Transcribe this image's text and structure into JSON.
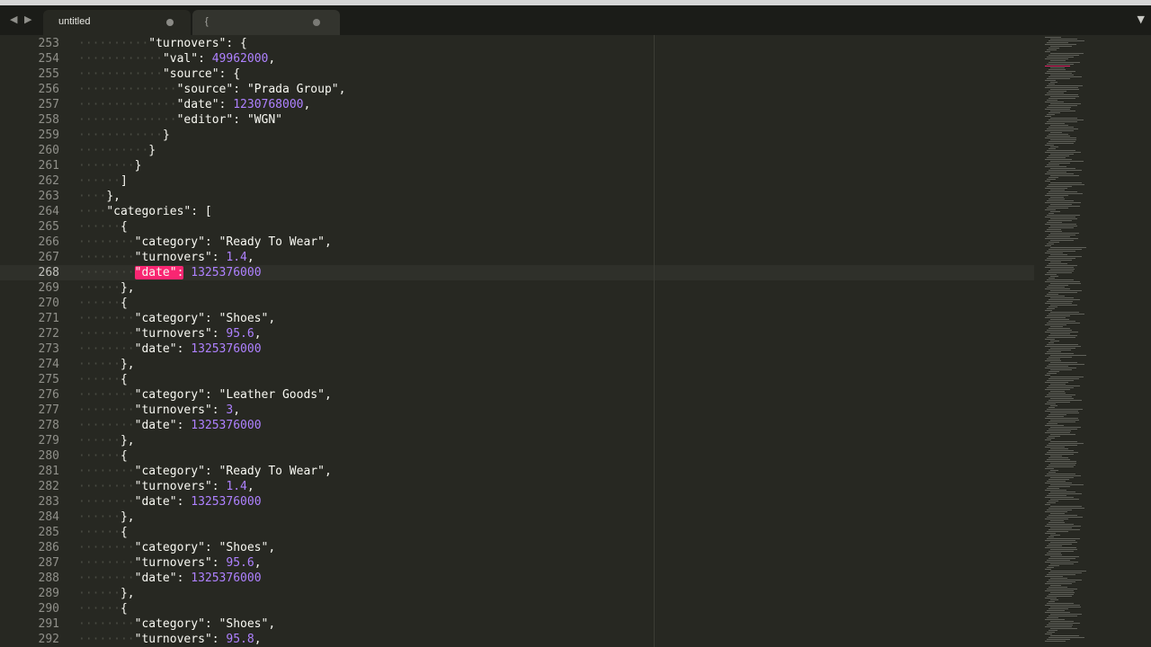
{
  "tabs": [
    {
      "label": "untitled",
      "active": true
    },
    {
      "label": "{",
      "active": false
    }
  ],
  "icons": {
    "nav_back": "◀",
    "nav_forward": "▶",
    "tab_menu": "▼"
  },
  "colors": {
    "background": "#272822",
    "number": "#ae81ff",
    "highlight": "#f92672",
    "text": "#f8f8f2"
  },
  "editor": {
    "current_line": 268,
    "lines": [
      {
        "n": "253",
        "indent": 5,
        "parts": [
          {
            "t": "\"turnovers\": {",
            "c": "s"
          }
        ]
      },
      {
        "n": "254",
        "indent": 6,
        "parts": [
          {
            "t": "\"val\": ",
            "c": "s"
          },
          {
            "t": "49962000",
            "c": "num"
          },
          {
            "t": ",",
            "c": "s"
          }
        ]
      },
      {
        "n": "255",
        "indent": 6,
        "parts": [
          {
            "t": "\"source\": {",
            "c": "s"
          }
        ]
      },
      {
        "n": "256",
        "indent": 7,
        "parts": [
          {
            "t": "\"source\": \"Prada Group\",",
            "c": "s"
          }
        ]
      },
      {
        "n": "257",
        "indent": 7,
        "parts": [
          {
            "t": "\"date\": ",
            "c": "s"
          },
          {
            "t": "1230768000",
            "c": "num"
          },
          {
            "t": ",",
            "c": "s"
          }
        ]
      },
      {
        "n": "258",
        "indent": 7,
        "parts": [
          {
            "t": "\"editor\": \"WGN\"",
            "c": "s"
          }
        ]
      },
      {
        "n": "259",
        "indent": 6,
        "parts": [
          {
            "t": "}",
            "c": "s"
          }
        ]
      },
      {
        "n": "260",
        "indent": 5,
        "parts": [
          {
            "t": "}",
            "c": "s"
          }
        ]
      },
      {
        "n": "261",
        "indent": 4,
        "parts": [
          {
            "t": "}",
            "c": "s"
          }
        ]
      },
      {
        "n": "262",
        "indent": 3,
        "parts": [
          {
            "t": "]",
            "c": "s"
          }
        ]
      },
      {
        "n": "263",
        "indent": 2,
        "parts": [
          {
            "t": "},",
            "c": "s"
          }
        ]
      },
      {
        "n": "264",
        "indent": 2,
        "parts": [
          {
            "t": "\"categories\": [",
            "c": "s"
          }
        ]
      },
      {
        "n": "265",
        "indent": 3,
        "parts": [
          {
            "t": "{",
            "c": "s"
          }
        ]
      },
      {
        "n": "266",
        "indent": 4,
        "parts": [
          {
            "t": "\"category\": \"Ready To Wear\",",
            "c": "s"
          }
        ]
      },
      {
        "n": "267",
        "indent": 4,
        "parts": [
          {
            "t": "\"turnovers\": ",
            "c": "s"
          },
          {
            "t": "1.4",
            "c": "num"
          },
          {
            "t": ",",
            "c": "s"
          }
        ]
      },
      {
        "n": "268",
        "indent": 4,
        "parts": [
          {
            "t": "\"date\":",
            "c": "hl"
          },
          {
            "t": " ",
            "c": "s"
          },
          {
            "t": "1325376000",
            "c": "num"
          }
        ]
      },
      {
        "n": "269",
        "indent": 3,
        "parts": [
          {
            "t": "},",
            "c": "s"
          }
        ]
      },
      {
        "n": "270",
        "indent": 3,
        "parts": [
          {
            "t": "{",
            "c": "s"
          }
        ]
      },
      {
        "n": "271",
        "indent": 4,
        "parts": [
          {
            "t": "\"category\": \"Shoes\",",
            "c": "s"
          }
        ]
      },
      {
        "n": "272",
        "indent": 4,
        "parts": [
          {
            "t": "\"turnovers\": ",
            "c": "s"
          },
          {
            "t": "95.6",
            "c": "num"
          },
          {
            "t": ",",
            "c": "s"
          }
        ]
      },
      {
        "n": "273",
        "indent": 4,
        "parts": [
          {
            "t": "\"date\": ",
            "c": "s"
          },
          {
            "t": "1325376000",
            "c": "num"
          }
        ]
      },
      {
        "n": "274",
        "indent": 3,
        "parts": [
          {
            "t": "},",
            "c": "s"
          }
        ]
      },
      {
        "n": "275",
        "indent": 3,
        "parts": [
          {
            "t": "{",
            "c": "s"
          }
        ]
      },
      {
        "n": "276",
        "indent": 4,
        "parts": [
          {
            "t": "\"category\": \"Leather Goods\",",
            "c": "s"
          }
        ]
      },
      {
        "n": "277",
        "indent": 4,
        "parts": [
          {
            "t": "\"turnovers\": ",
            "c": "s"
          },
          {
            "t": "3",
            "c": "num"
          },
          {
            "t": ",",
            "c": "s"
          }
        ]
      },
      {
        "n": "278",
        "indent": 4,
        "parts": [
          {
            "t": "\"date\": ",
            "c": "s"
          },
          {
            "t": "1325376000",
            "c": "num"
          }
        ]
      },
      {
        "n": "279",
        "indent": 3,
        "parts": [
          {
            "t": "},",
            "c": "s"
          }
        ]
      },
      {
        "n": "280",
        "indent": 3,
        "parts": [
          {
            "t": "{",
            "c": "s"
          }
        ]
      },
      {
        "n": "281",
        "indent": 4,
        "parts": [
          {
            "t": "\"category\": \"Ready To Wear\",",
            "c": "s"
          }
        ]
      },
      {
        "n": "282",
        "indent": 4,
        "parts": [
          {
            "t": "\"turnovers\": ",
            "c": "s"
          },
          {
            "t": "1.4",
            "c": "num"
          },
          {
            "t": ",",
            "c": "s"
          }
        ]
      },
      {
        "n": "283",
        "indent": 4,
        "parts": [
          {
            "t": "\"date\": ",
            "c": "s"
          },
          {
            "t": "1325376000",
            "c": "num"
          }
        ]
      },
      {
        "n": "284",
        "indent": 3,
        "parts": [
          {
            "t": "},",
            "c": "s"
          }
        ]
      },
      {
        "n": "285",
        "indent": 3,
        "parts": [
          {
            "t": "{",
            "c": "s"
          }
        ]
      },
      {
        "n": "286",
        "indent": 4,
        "parts": [
          {
            "t": "\"category\": \"Shoes\",",
            "c": "s"
          }
        ]
      },
      {
        "n": "287",
        "indent": 4,
        "parts": [
          {
            "t": "\"turnovers\": ",
            "c": "s"
          },
          {
            "t": "95.6",
            "c": "num"
          },
          {
            "t": ",",
            "c": "s"
          }
        ]
      },
      {
        "n": "288",
        "indent": 4,
        "parts": [
          {
            "t": "\"date\": ",
            "c": "s"
          },
          {
            "t": "1325376000",
            "c": "num"
          }
        ]
      },
      {
        "n": "289",
        "indent": 3,
        "parts": [
          {
            "t": "},",
            "c": "s"
          }
        ]
      },
      {
        "n": "290",
        "indent": 3,
        "parts": [
          {
            "t": "{",
            "c": "s"
          }
        ]
      },
      {
        "n": "291",
        "indent": 4,
        "parts": [
          {
            "t": "\"category\": \"Shoes\",",
            "c": "s"
          }
        ]
      },
      {
        "n": "292",
        "indent": 4,
        "parts": [
          {
            "t": "\"turnovers\": ",
            "c": "s"
          },
          {
            "t": "95.8",
            "c": "num"
          },
          {
            "t": ",",
            "c": "s"
          }
        ]
      }
    ]
  }
}
